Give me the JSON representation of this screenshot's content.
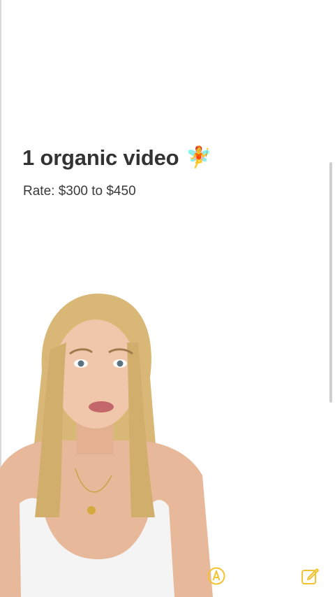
{
  "note": {
    "title": "1 organic video",
    "title_emoji": "🧚",
    "rate_text": "Rate: $300 to $450"
  },
  "toolbar": {
    "markup_icon": "markup-pen-icon",
    "compose_icon": "compose-note-icon"
  },
  "colors": {
    "accent": "#f2c230",
    "text_primary": "#333333",
    "background": "#ffffff"
  }
}
